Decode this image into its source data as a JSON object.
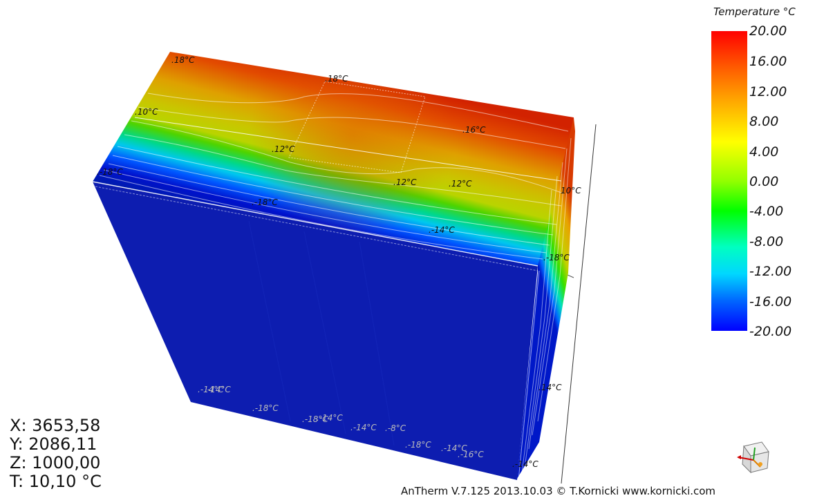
{
  "scene": {
    "isotherm_labels": {
      "top": [
        ".18°C",
        ".18°C",
        ".10°C",
        ".12°C",
        ".16°C",
        ".-18°C",
        ".12°C",
        ".12°C",
        ".-18°C",
        ".-14°C",
        "10°C"
      ],
      "side": [
        ".-18°C",
        ".14°C",
        ".-14°C"
      ],
      "bottom": [
        ".-14°C",
        ".-18°C",
        ".-18°C",
        ".-14°C",
        ".-14°C",
        ".-8°C",
        ".-18°C",
        ".-14°C",
        ".-16°C",
        ".-14°C"
      ]
    }
  },
  "legend": {
    "title": "Temperature °C",
    "ticks": [
      "20.00",
      "16.00",
      "12.00",
      "8.00",
      "4.00",
      "0.00",
      "-4.00",
      "-8.00",
      "-12.00",
      "-16.00",
      "-20.00"
    ],
    "colors": {
      "max": "#ff0000",
      "hot": "#ff9f00",
      "warm": "#ffff00",
      "mid": "#00ff00",
      "cool": "#00ffc0",
      "cold": "#0066ff",
      "min": "#0000ff"
    }
  },
  "readout": {
    "x": "X: 3653,58",
    "y": "Y: 2086,11",
    "z": "Z: 1000,00",
    "t": "T: 10,10 °C"
  },
  "footer": {
    "text": "AnTherm V.7.125 2013.10.03 © T.Kornicki www.kornicki.com"
  },
  "orientation_widget": {
    "icon": "orientation-cube-icon"
  }
}
